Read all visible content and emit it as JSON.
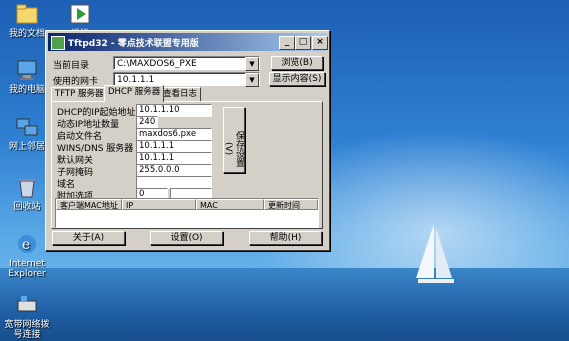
{
  "desktop": {
    "icons": [
      {
        "label": "我的文档"
      },
      {
        "label": "运行"
      },
      {
        "label": "我的电脑"
      },
      {
        "label": "网上邻居"
      },
      {
        "label": "回收站"
      },
      {
        "label": "Internet Explorer"
      },
      {
        "label": "宽带网络拨号连接"
      }
    ]
  },
  "window": {
    "title": "Tftpd32 - 零点技术联盟专用版",
    "minimize": "_",
    "maximize": "□",
    "close": "×",
    "current_dir_label": "当前目录",
    "current_dir_value": "C:\\MAXDOS6_PXE",
    "nic_label": "使用的网卡",
    "nic_value": "10.1.1.1",
    "browse_button": "浏览(B)",
    "show_button": "显示内容(S)",
    "tabs": [
      "TFTP 服务器",
      "DHCP 服务器",
      "查看日志"
    ],
    "dhcp": {
      "fields": [
        {
          "label": "DHCP的IP起始地址",
          "value": "10.1.1.10"
        },
        {
          "label": "动态IP地址数量",
          "value": "240"
        },
        {
          "label": "启动文件名",
          "value": "maxdos6.pxe"
        },
        {
          "label": "WINS/DNS 服务器",
          "value": "10.1.1.1"
        },
        {
          "label": "默认网关",
          "value": "10.1.1.1"
        },
        {
          "label": "子网掩码",
          "value": "255.0.0.0"
        },
        {
          "label": "域名",
          "value": ""
        },
        {
          "label": "附加选项",
          "value": "0"
        }
      ],
      "save_button": "保存设置(V)",
      "columns": [
        "客户端MAC地址",
        "IP",
        "MAC",
        "更新时间"
      ]
    },
    "about_button": "关于(A)",
    "settings_button": "设置(O)",
    "help_button": "帮助(H)"
  }
}
